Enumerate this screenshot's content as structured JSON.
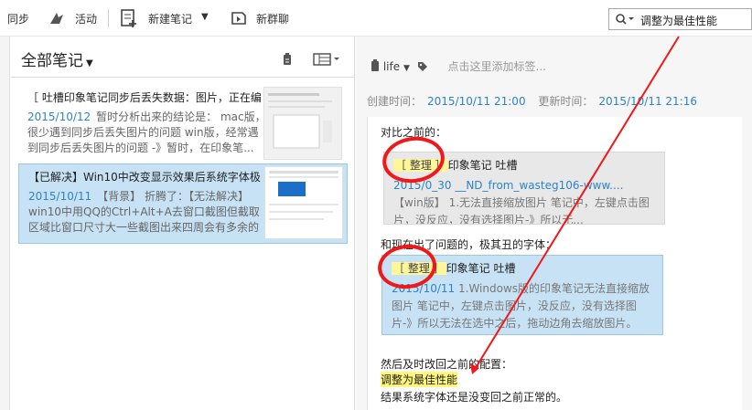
{
  "toolbar": {
    "sync_label": "同步",
    "activity_label": "活动",
    "new_note_label": "新建笔记",
    "new_chat_label": "新群聊",
    "search_value": "调整为最佳性能"
  },
  "list": {
    "title": "全部笔记",
    "notes": [
      {
        "title": "［ 吐槽印象笔记同步后丢失数据：图片，正在编...",
        "date": "2015/10/12",
        "snippet": "暂时分析出来的结论是： mac版，很少遇到同步后丢失图片的问题 win版，经常遇到同步后丢失图片的问题 -》暂时，在印象笔..."
      },
      {
        "title": "【已解决】Win10中改变显示效果后系统字体极...",
        "date": "2015/10/11",
        "snippet": "【背景】 折腾了：【无法解决】win10中用QQ的Ctrl+Alt+A去窗口截图但截取区域比窗口尺寸大一些截图出来四周会有多余的内..."
      }
    ]
  },
  "detail": {
    "notebook": "life",
    "tag_hint": "点击这里添加标签...",
    "created_label": "创建时间：",
    "created": "2015/10/11 21:00",
    "updated_label": "更新时间：",
    "updated": "2015/10/11 21:16",
    "line_before": "对比之前的：",
    "card1": {
      "tag": "［ 整理 ］",
      "title": "印象笔记 吐槽",
      "date": "2015/0_30",
      "source": "__ND_from_wasteg106-www....",
      "body": "【win版】 1.无法直接缩放图片 笔记中，左键点击图片，没反应，没有选择图片-》所以无..."
    },
    "line_after": "和现在出了问题的，极其丑的字体：",
    "card2": {
      "tag": "［ 整理 ］",
      "title": "印象笔记 吐槽",
      "date": "2015/10/11",
      "body": "1.Windows版的印象笔记无法直接缩放图片 笔记中，左键点击图片，没反应，没有选择图片-》所以无法在选中之后，拖动边角去缩放图片。 而..."
    },
    "line3": "然后及时改回之前的配置：",
    "highlight": "调整为最佳性能",
    "line4": "结果系统字体还是没变回之前正常的。"
  },
  "colors": {
    "accent": "#2d83c8",
    "selection": "#c7e2f4",
    "annotation": "#f01818",
    "highlight": "#fff67a"
  }
}
